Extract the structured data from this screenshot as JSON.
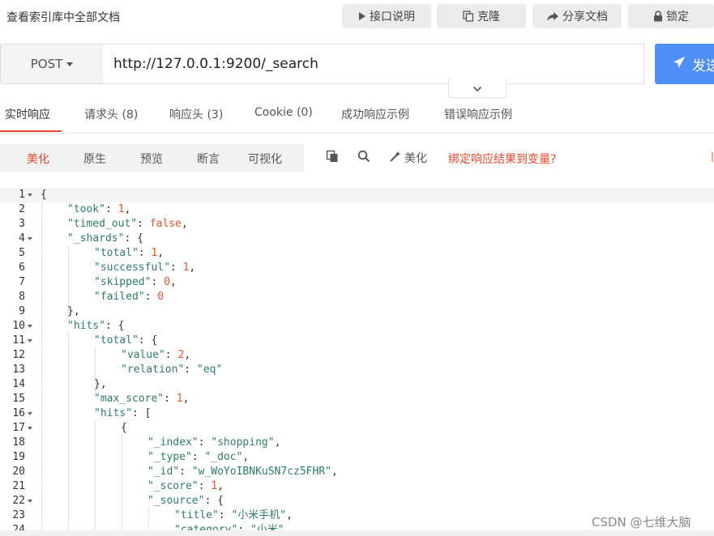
{
  "header": {
    "title": "查看索引库中全部文档",
    "buttons": [
      {
        "label": "接口说明",
        "icon": "play-icon"
      },
      {
        "label": "克隆",
        "icon": "copy-icon"
      },
      {
        "label": "分享文档",
        "icon": "share-icon"
      },
      {
        "label": "锁定",
        "icon": "lock-icon"
      }
    ]
  },
  "request": {
    "method": "POST",
    "url": "http://127.0.0.1:9200/_search",
    "send_label": "发送"
  },
  "tabs": [
    {
      "label": "实时响应",
      "active": true
    },
    {
      "label": "请求头 (8)"
    },
    {
      "label": "响应头 (3)"
    },
    {
      "label": "Cookie (0)"
    },
    {
      "label": "成功响应示例"
    },
    {
      "label": "错误响应示例"
    }
  ],
  "viewmodes": [
    {
      "label": "美化",
      "active": true
    },
    {
      "label": "原生"
    },
    {
      "label": "预览"
    },
    {
      "label": "断言"
    },
    {
      "label": "可视化"
    }
  ],
  "toolbar": {
    "beautify_label": "美化",
    "bind_link": "绑定响应结果到变量?"
  },
  "colors": {
    "accent": "#e9472e",
    "send": "#4f8ef7",
    "key": "#2e7d6b",
    "number": "#e2572b"
  },
  "code_lines": [
    {
      "n": "1",
      "fold": true,
      "indent": 0,
      "tokens": [
        [
          "p",
          "{"
        ]
      ]
    },
    {
      "n": "2",
      "indent": 1,
      "tokens": [
        [
          "k",
          "\"took\""
        ],
        [
          "p",
          ": "
        ],
        [
          "n",
          "1"
        ],
        [
          "p",
          ","
        ]
      ]
    },
    {
      "n": "3",
      "indent": 1,
      "tokens": [
        [
          "k",
          "\"timed_out\""
        ],
        [
          "p",
          ": "
        ],
        [
          "b",
          "false"
        ],
        [
          "p",
          ","
        ]
      ]
    },
    {
      "n": "4",
      "fold": true,
      "indent": 1,
      "tokens": [
        [
          "k",
          "\"_shards\""
        ],
        [
          "p",
          ": {"
        ]
      ]
    },
    {
      "n": "5",
      "indent": 2,
      "tokens": [
        [
          "k",
          "\"total\""
        ],
        [
          "p",
          ": "
        ],
        [
          "n",
          "1"
        ],
        [
          "p",
          ","
        ]
      ]
    },
    {
      "n": "6",
      "indent": 2,
      "tokens": [
        [
          "k",
          "\"successful\""
        ],
        [
          "p",
          ": "
        ],
        [
          "n",
          "1"
        ],
        [
          "p",
          ","
        ]
      ]
    },
    {
      "n": "7",
      "indent": 2,
      "tokens": [
        [
          "k",
          "\"skipped\""
        ],
        [
          "p",
          ": "
        ],
        [
          "n",
          "0"
        ],
        [
          "p",
          ","
        ]
      ]
    },
    {
      "n": "8",
      "indent": 2,
      "tokens": [
        [
          "k",
          "\"failed\""
        ],
        [
          "p",
          ": "
        ],
        [
          "n",
          "0"
        ]
      ]
    },
    {
      "n": "9",
      "indent": 1,
      "tokens": [
        [
          "p",
          "},"
        ]
      ]
    },
    {
      "n": "10",
      "fold": true,
      "indent": 1,
      "tokens": [
        [
          "k",
          "\"hits\""
        ],
        [
          "p",
          ": {"
        ]
      ]
    },
    {
      "n": "11",
      "fold": true,
      "indent": 2,
      "tokens": [
        [
          "k",
          "\"total\""
        ],
        [
          "p",
          ": {"
        ]
      ]
    },
    {
      "n": "12",
      "indent": 3,
      "tokens": [
        [
          "k",
          "\"value\""
        ],
        [
          "p",
          ": "
        ],
        [
          "n",
          "2"
        ],
        [
          "p",
          ","
        ]
      ]
    },
    {
      "n": "13",
      "indent": 3,
      "tokens": [
        [
          "k",
          "\"relation\""
        ],
        [
          "p",
          ": "
        ],
        [
          "s",
          "\"eq\""
        ]
      ]
    },
    {
      "n": "14",
      "indent": 2,
      "tokens": [
        [
          "p",
          "},"
        ]
      ]
    },
    {
      "n": "15",
      "indent": 2,
      "tokens": [
        [
          "k",
          "\"max_score\""
        ],
        [
          "p",
          ": "
        ],
        [
          "n",
          "1"
        ],
        [
          "p",
          ","
        ]
      ]
    },
    {
      "n": "16",
      "fold": true,
      "indent": 2,
      "tokens": [
        [
          "k",
          "\"hits\""
        ],
        [
          "p",
          ": ["
        ]
      ]
    },
    {
      "n": "17",
      "fold": true,
      "indent": 3,
      "tokens": [
        [
          "p",
          "{"
        ]
      ]
    },
    {
      "n": "18",
      "indent": 4,
      "tokens": [
        [
          "k",
          "\"_index\""
        ],
        [
          "p",
          ": "
        ],
        [
          "s",
          "\"shopping\""
        ],
        [
          "p",
          ","
        ]
      ]
    },
    {
      "n": "19",
      "indent": 4,
      "tokens": [
        [
          "k",
          "\"_type\""
        ],
        [
          "p",
          ": "
        ],
        [
          "s",
          "\"_doc\""
        ],
        [
          "p",
          ","
        ]
      ]
    },
    {
      "n": "20",
      "indent": 4,
      "tokens": [
        [
          "k",
          "\"_id\""
        ],
        [
          "p",
          ": "
        ],
        [
          "s",
          "\"w_WoYoIBNKuSN7cz5FHR\""
        ],
        [
          "p",
          ","
        ]
      ]
    },
    {
      "n": "21",
      "indent": 4,
      "tokens": [
        [
          "k",
          "\"_score\""
        ],
        [
          "p",
          ": "
        ],
        [
          "n",
          "1"
        ],
        [
          "p",
          ","
        ]
      ]
    },
    {
      "n": "22",
      "fold": true,
      "indent": 4,
      "tokens": [
        [
          "k",
          "\"_source\""
        ],
        [
          "p",
          ": {"
        ]
      ]
    },
    {
      "n": "23",
      "indent": 5,
      "tokens": [
        [
          "k",
          "\"title\""
        ],
        [
          "p",
          ": "
        ],
        [
          "s",
          "\"小米手机\""
        ],
        [
          "p",
          ","
        ]
      ]
    },
    {
      "n": "24",
      "indent": 5,
      "tokens": [
        [
          "k",
          "\"category\""
        ],
        [
          "p",
          ": "
        ],
        [
          "s",
          "\"小米\""
        ],
        [
          "p",
          ","
        ]
      ]
    }
  ],
  "watermark": "CSDN @七维大脑"
}
